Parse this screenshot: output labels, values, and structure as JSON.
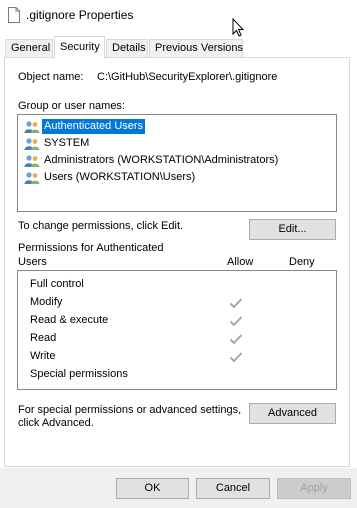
{
  "window": {
    "title": ".gitignore Properties"
  },
  "tabs": [
    {
      "label": "General"
    },
    {
      "label": "Security"
    },
    {
      "label": "Details"
    },
    {
      "label": "Previous Versions"
    }
  ],
  "object": {
    "label": "Object name:",
    "value": "C:\\GitHub\\SecurityExplorer\\.gitignore"
  },
  "groups": {
    "label": "Group or user names:",
    "items": [
      {
        "label": "Authenticated Users",
        "selected": true
      },
      {
        "label": "SYSTEM"
      },
      {
        "label": "Administrators (WORKSTATION\\Administrators)"
      },
      {
        "label": "Users (WORKSTATION\\Users)"
      }
    ]
  },
  "change_hint": "To change permissions, click Edit.",
  "edit_button": "Edit...",
  "permissions": {
    "header_line1": "Permissions for Authenticated",
    "header_line2": "Users",
    "allow_label": "Allow",
    "deny_label": "Deny",
    "items": [
      {
        "label": "Full control",
        "allow": false
      },
      {
        "label": "Modify",
        "allow": true
      },
      {
        "label": "Read & execute",
        "allow": true
      },
      {
        "label": "Read",
        "allow": true
      },
      {
        "label": "Write",
        "allow": true
      },
      {
        "label": "Special permissions",
        "allow": false
      }
    ]
  },
  "advanced": {
    "hint_line1": "For special permissions or advanced settings,",
    "hint_line2": "click Advanced.",
    "button": "Advanced"
  },
  "footer": {
    "ok": "OK",
    "cancel": "Cancel",
    "apply": "Apply"
  },
  "colors": {
    "selection": "#0078d7",
    "check": "#a6a6a6"
  }
}
